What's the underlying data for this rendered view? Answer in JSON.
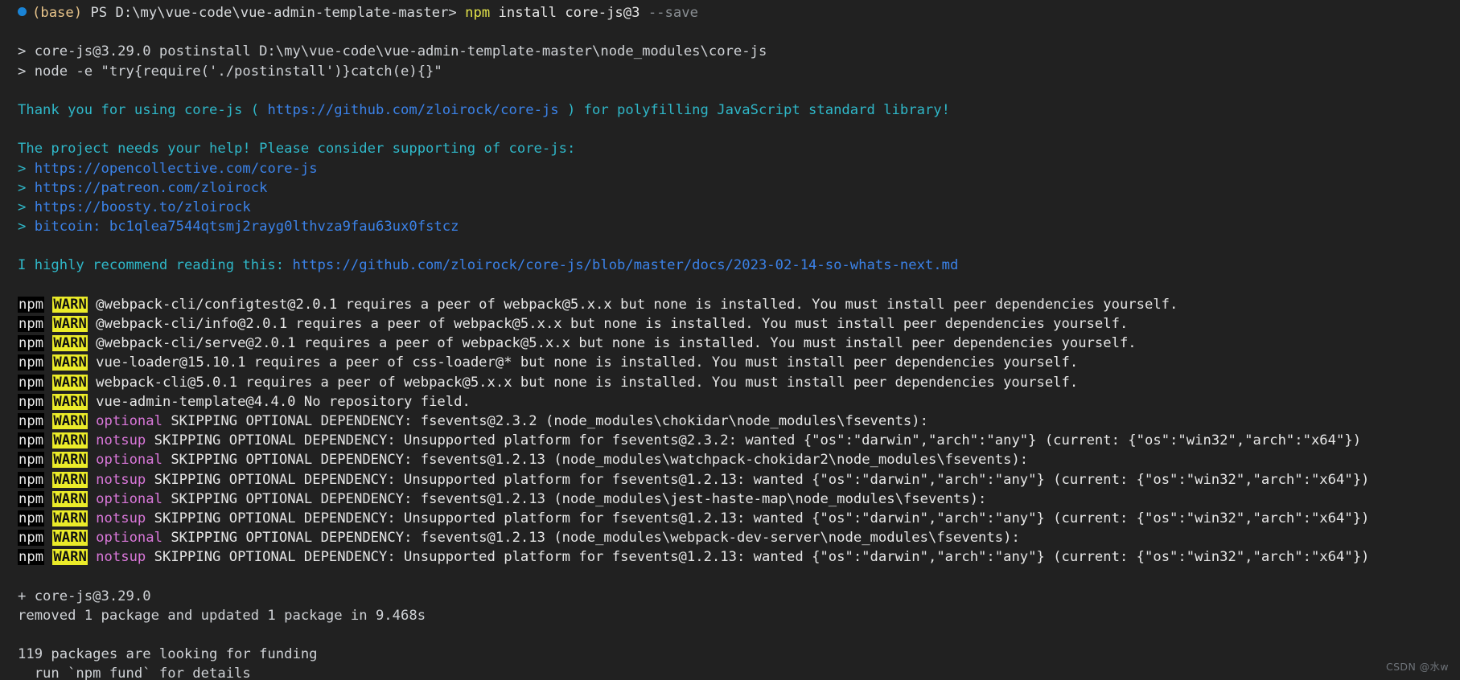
{
  "terminal": {
    "background_color": "#212121",
    "default_text_color": "#cfd2d6",
    "prompt": {
      "bullet_icon": "blue-dot-icon",
      "env": "(base)",
      "shell": "PS",
      "path": "D:\\my\\vue-code\\vue-admin-template-master>",
      "command_name": "npm",
      "command_args": "install core-js@3",
      "command_flag": "--save"
    },
    "postinstall": {
      "line1": "> core-js@3.29.0 postinstall D:\\my\\vue-code\\vue-admin-template-master\\node_modules\\core-js",
      "line2": "> node -e \"try{require('./postinstall')}catch(e){}\""
    },
    "thanks": {
      "prefix": "Thank you for using core-js ( ",
      "url": "https://github.com/zloirock/core-js",
      "suffix": " ) for polyfilling JavaScript standard library!"
    },
    "support": {
      "heading": "The project needs your help! Please consider supporting of core-js:",
      "links": [
        {
          "arrow": ">",
          "text": "https://opencollective.com/core-js"
        },
        {
          "arrow": ">",
          "text": "https://patreon.com/zloirock"
        },
        {
          "arrow": ">",
          "text": "https://boosty.to/zloirock"
        },
        {
          "arrow": ">",
          "text": "bitcoin: bc1qlea7544qtsmj2rayg0lthvza9fau63ux0fstcz"
        }
      ]
    },
    "recommend": {
      "prefix": "I highly recommend reading this: ",
      "url": "https://github.com/zloirock/core-js/blob/master/docs/2023-02-14-so-whats-next.md"
    },
    "warn_prefix": "npm",
    "warn_label": "WARN",
    "warnings": [
      {
        "tag": "",
        "text": "@webpack-cli/configtest@2.0.1 requires a peer of webpack@5.x.x but none is installed. You must install peer dependencies yourself."
      },
      {
        "tag": "",
        "text": "@webpack-cli/info@2.0.1 requires a peer of webpack@5.x.x but none is installed. You must install peer dependencies yourself."
      },
      {
        "tag": "",
        "text": "@webpack-cli/serve@2.0.1 requires a peer of webpack@5.x.x but none is installed. You must install peer dependencies yourself."
      },
      {
        "tag": "",
        "text": "vue-loader@15.10.1 requires a peer of css-loader@* but none is installed. You must install peer dependencies yourself."
      },
      {
        "tag": "",
        "text": "webpack-cli@5.0.1 requires a peer of webpack@5.x.x but none is installed. You must install peer dependencies yourself."
      },
      {
        "tag": "",
        "text": "vue-admin-template@4.4.0 No repository field."
      },
      {
        "tag": "optional",
        "text": "SKIPPING OPTIONAL DEPENDENCY: fsevents@2.3.2 (node_modules\\chokidar\\node_modules\\fsevents):"
      },
      {
        "tag": "notsup",
        "text": "SKIPPING OPTIONAL DEPENDENCY: Unsupported platform for fsevents@2.3.2: wanted {\"os\":\"darwin\",\"arch\":\"any\"} (current: {\"os\":\"win32\",\"arch\":\"x64\"})"
      },
      {
        "tag": "optional",
        "text": "SKIPPING OPTIONAL DEPENDENCY: fsevents@1.2.13 (node_modules\\watchpack-chokidar2\\node_modules\\fsevents):"
      },
      {
        "tag": "notsup",
        "text": "SKIPPING OPTIONAL DEPENDENCY: Unsupported platform for fsevents@1.2.13: wanted {\"os\":\"darwin\",\"arch\":\"any\"} (current: {\"os\":\"win32\",\"arch\":\"x64\"})"
      },
      {
        "tag": "optional",
        "text": "SKIPPING OPTIONAL DEPENDENCY: fsevents@1.2.13 (node_modules\\jest-haste-map\\node_modules\\fsevents):"
      },
      {
        "tag": "notsup",
        "text": "SKIPPING OPTIONAL DEPENDENCY: Unsupported platform for fsevents@1.2.13: wanted {\"os\":\"darwin\",\"arch\":\"any\"} (current: {\"os\":\"win32\",\"arch\":\"x64\"})"
      },
      {
        "tag": "optional",
        "text": "SKIPPING OPTIONAL DEPENDENCY: fsevents@1.2.13 (node_modules\\webpack-dev-server\\node_modules\\fsevents):"
      },
      {
        "tag": "notsup",
        "text": "SKIPPING OPTIONAL DEPENDENCY: Unsupported platform for fsevents@1.2.13: wanted {\"os\":\"darwin\",\"arch\":\"any\"} (current: {\"os\":\"win32\",\"arch\":\"x64\"})"
      }
    ],
    "summary": {
      "added": "+ core-js@3.29.0",
      "result": "removed 1 package and updated 1 package in 9.468s",
      "funding": "119 packages are looking for funding",
      "funding_hint": "  run `npm fund` for details"
    }
  },
  "watermark": "CSDN @水w",
  "colors": {
    "cyan": "#2fb7c8",
    "blue_link": "#3b82e8",
    "warn_bg": "#ebeb29",
    "magenta": "#d977d9",
    "npm_yellow": "#e0e04a"
  }
}
